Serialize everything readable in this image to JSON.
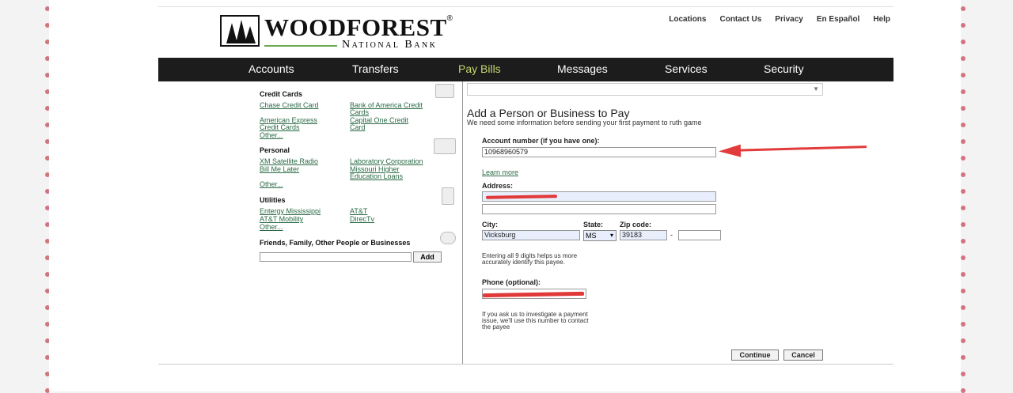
{
  "bank": {
    "name": "WOODFOREST",
    "registered": "®",
    "sub": "National Bank"
  },
  "util_nav": [
    "Locations",
    "Contact Us",
    "Privacy",
    "En Español",
    "Help"
  ],
  "nav": {
    "items": [
      "Accounts",
      "Transfers",
      "Pay Bills",
      "Messages",
      "Services",
      "Security"
    ],
    "active": "Pay Bills",
    "active_color": "#c5d86d"
  },
  "sidebar": {
    "credit_cards": {
      "heading": "Credit Cards",
      "links": [
        "Chase Credit Card",
        "Bank of America Credit Cards",
        "American Express Credit Cards",
        "Capital One Credit Card",
        "Other..."
      ]
    },
    "personal": {
      "heading": "Personal",
      "links": [
        "XM Satellite Radio",
        "Laboratory Corporation",
        "Bill Me Later",
        "Missouri Higher Education Loans",
        "Other..."
      ]
    },
    "utilities": {
      "heading": "Utilities",
      "links": [
        "Entergy Mississippi",
        "AT&T",
        "AT&T Mobility",
        "DirecTv",
        "Other..."
      ]
    },
    "friends": {
      "heading": "Friends, Family, Other People or Businesses",
      "add_label": "Add"
    }
  },
  "form": {
    "title": "Add a Person or Business to Pay",
    "subtitle": "We need some information before sending your first payment to ruth game",
    "account_label": "Account number (if you have one):",
    "account_value": "10968960579",
    "learn_more": "Learn more",
    "address_label": "Address:",
    "city_label": "City:",
    "city_value": "Vicksburg",
    "state_label": "State:",
    "state_value": "MS",
    "zip_label": "Zip code:",
    "zip_value": "39183",
    "zip_dash": "-",
    "zip_help": "Entering all 9 digits helps us more accurately identify this payee.",
    "phone_label": "Phone (optional):",
    "phone_help": "If you ask us to investigate a payment issue, we'll use this number to contact the payee",
    "continue_label": "Continue",
    "cancel_label": "Cancel"
  },
  "colors": {
    "annotation_arrow": "#e23b3b",
    "redaction": "#e13838",
    "link": "#2a6a45",
    "navbar": "#1c1c1c"
  }
}
